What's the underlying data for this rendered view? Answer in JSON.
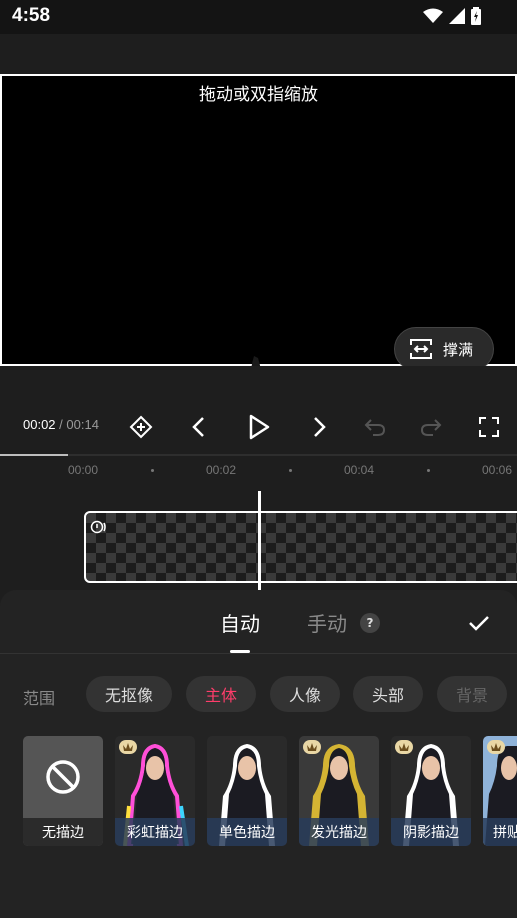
{
  "status": {
    "time": "4:58"
  },
  "preview": {
    "hint": "拖动或双指缩放",
    "fill_label": "撑满"
  },
  "player": {
    "current": "00:02",
    "separator": " / ",
    "total": "00:14"
  },
  "timeline": {
    "ticks": [
      "00:00",
      "00:02",
      "00:04",
      "00:06"
    ]
  },
  "panel": {
    "tabs": [
      {
        "label": "自动"
      },
      {
        "label": "手动"
      }
    ],
    "help": "?",
    "scope_label": "范围",
    "scopes": [
      {
        "label": "无抠像"
      },
      {
        "label": "主体"
      },
      {
        "label": "人像"
      },
      {
        "label": "头部"
      },
      {
        "label": "背景"
      }
    ],
    "styles": [
      {
        "label": "无描边"
      },
      {
        "label": "彩虹描边"
      },
      {
        "label": "单色描边"
      },
      {
        "label": "发光描边"
      },
      {
        "label": "阴影描边"
      },
      {
        "label": "拼贴"
      }
    ]
  },
  "colors": {
    "accent": "#ff3d6b",
    "panel_bg": "#232323"
  }
}
